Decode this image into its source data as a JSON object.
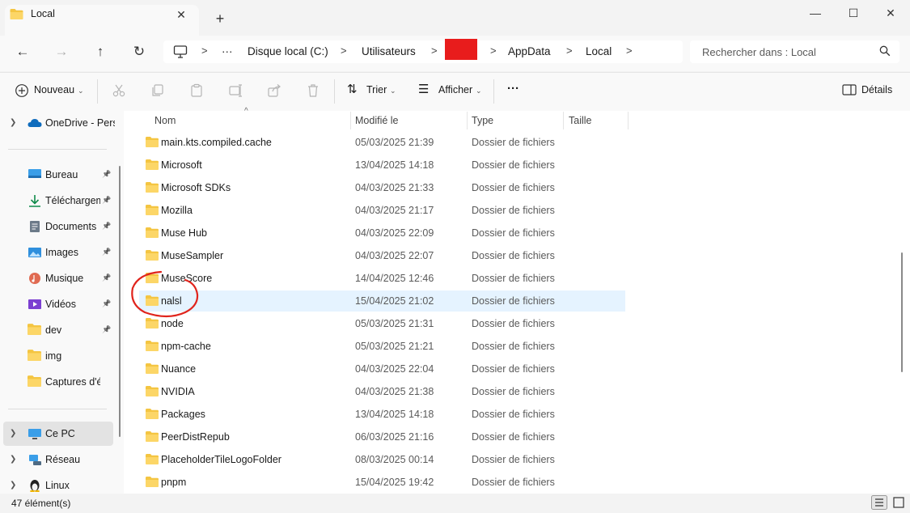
{
  "tab": {
    "title": "Local",
    "close_icon": "close-icon",
    "new_tab_icon": "plus-icon"
  },
  "window_controls": {
    "minimize": "minimize-icon",
    "maximize": "maximize-icon",
    "close": "close-icon"
  },
  "breadcrumb": {
    "items": [
      "Disque local (C:)",
      "Utilisateurs",
      "AppData",
      "Local"
    ],
    "overflow": "···",
    "redaction_color": "#e81c1c"
  },
  "search": {
    "placeholder": "Rechercher dans : Local"
  },
  "toolbar": {
    "new_label": "Nouveau",
    "sort_label": "Trier",
    "view_label": "Afficher",
    "more_label": "···",
    "details_label": "Détails"
  },
  "sidebar": {
    "onedrive": "OneDrive - Perso",
    "quick": [
      {
        "label": "Bureau",
        "icon": "desktop-icon"
      },
      {
        "label": "Téléchargements",
        "icon": "download-icon"
      },
      {
        "label": "Documents",
        "icon": "documents-icon"
      },
      {
        "label": "Images",
        "icon": "images-icon"
      },
      {
        "label": "Musique",
        "icon": "music-icon"
      },
      {
        "label": "Vidéos",
        "icon": "videos-icon"
      },
      {
        "label": "dev",
        "icon": "folder-icon"
      },
      {
        "label": "img",
        "icon": "folder-icon"
      },
      {
        "label": "Captures d'écran",
        "icon": "folder-icon"
      }
    ],
    "this_pc": "Ce PC",
    "network": "Réseau",
    "linux": "Linux"
  },
  "columns": {
    "name": "Nom",
    "modified": "Modifié le",
    "type": "Type",
    "size": "Taille"
  },
  "files": [
    {
      "name": "main.kts.compiled.cache",
      "modified": "05/03/2025 21:39",
      "type": "Dossier de fichiers"
    },
    {
      "name": "Microsoft",
      "modified": "13/04/2025 14:18",
      "type": "Dossier de fichiers"
    },
    {
      "name": "Microsoft SDKs",
      "modified": "04/03/2025 21:33",
      "type": "Dossier de fichiers"
    },
    {
      "name": "Mozilla",
      "modified": "04/03/2025 21:17",
      "type": "Dossier de fichiers"
    },
    {
      "name": "Muse Hub",
      "modified": "04/03/2025 22:09",
      "type": "Dossier de fichiers"
    },
    {
      "name": "MuseSampler",
      "modified": "04/03/2025 22:07",
      "type": "Dossier de fichiers"
    },
    {
      "name": "MuseScore",
      "modified": "14/04/2025 12:46",
      "type": "Dossier de fichiers"
    },
    {
      "name": "nalsl",
      "modified": "15/04/2025 21:02",
      "type": "Dossier de fichiers",
      "selected": true
    },
    {
      "name": "node",
      "modified": "05/03/2025 21:31",
      "type": "Dossier de fichiers"
    },
    {
      "name": "npm-cache",
      "modified": "05/03/2025 21:21",
      "type": "Dossier de fichiers"
    },
    {
      "name": "Nuance",
      "modified": "04/03/2025 22:04",
      "type": "Dossier de fichiers"
    },
    {
      "name": "NVIDIA",
      "modified": "04/03/2025 21:38",
      "type": "Dossier de fichiers"
    },
    {
      "name": "Packages",
      "modified": "13/04/2025 14:18",
      "type": "Dossier de fichiers"
    },
    {
      "name": "PeerDistRepub",
      "modified": "06/03/2025 21:16",
      "type": "Dossier de fichiers"
    },
    {
      "name": "PlaceholderTileLogoFolder",
      "modified": "08/03/2025 00:14",
      "type": "Dossier de fichiers"
    },
    {
      "name": "pnpm",
      "modified": "15/04/2025 19:42",
      "type": "Dossier de fichiers"
    }
  ],
  "status": {
    "count": "47 élément(s)"
  },
  "colors": {
    "folder": "#f4c542",
    "selection": "#e5f3ff",
    "annotation": "#e0241c",
    "accent": "#0067c0"
  }
}
